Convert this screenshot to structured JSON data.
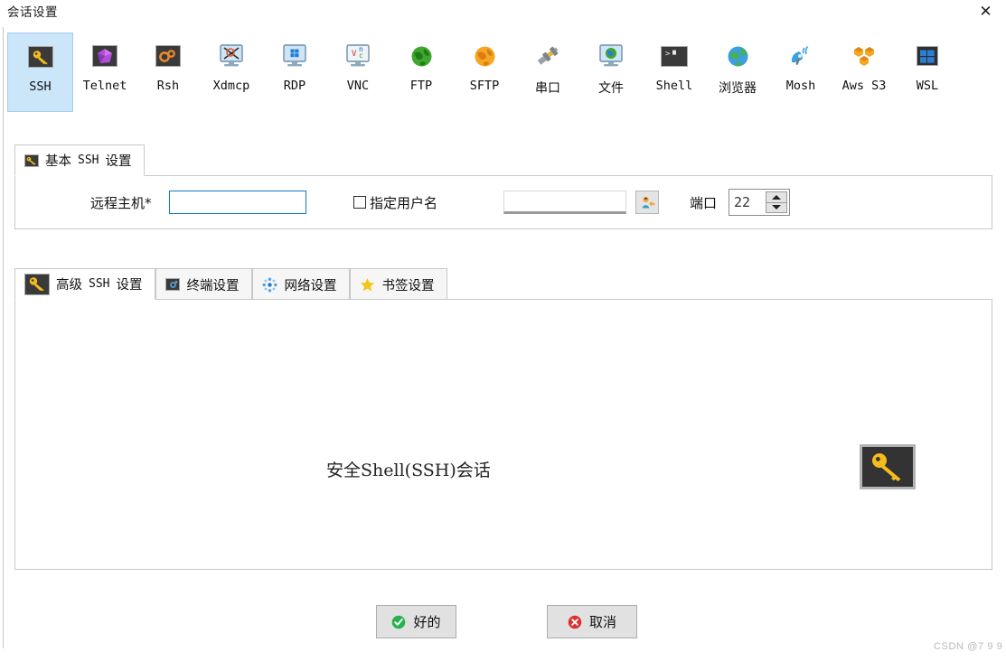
{
  "window": {
    "title": "会话设置",
    "close_label": "✕"
  },
  "protocols": [
    {
      "label": "SSH",
      "icon": "key-icon",
      "selected": true,
      "cjk": false
    },
    {
      "label": "Telnet",
      "icon": "gem-icon",
      "selected": false,
      "cjk": false
    },
    {
      "label": "Rsh",
      "icon": "gears-icon",
      "selected": false,
      "cjk": false
    },
    {
      "label": "Xdmcp",
      "icon": "x-monitor-icon",
      "selected": false,
      "cjk": false
    },
    {
      "label": "RDP",
      "icon": "windows-monitor-icon",
      "selected": false,
      "cjk": false
    },
    {
      "label": "VNC",
      "icon": "vnc-monitor-icon",
      "selected": false,
      "cjk": false
    },
    {
      "label": "FTP",
      "icon": "green-globe-icon",
      "selected": false,
      "cjk": false
    },
    {
      "label": "SFTP",
      "icon": "orange-globe-icon",
      "selected": false,
      "cjk": false
    },
    {
      "label": "串口",
      "icon": "serial-plug-icon",
      "selected": false,
      "cjk": true
    },
    {
      "label": "文件",
      "icon": "file-monitor-icon",
      "selected": false,
      "cjk": true
    },
    {
      "label": "Shell",
      "icon": "terminal-icon",
      "selected": false,
      "cjk": false
    },
    {
      "label": "浏览器",
      "icon": "browser-globe-icon",
      "selected": false,
      "cjk": true
    },
    {
      "label": "Mosh",
      "icon": "satellite-icon",
      "selected": false,
      "cjk": false
    },
    {
      "label": "Aws S3",
      "icon": "aws-cubes-icon",
      "selected": false,
      "cjk": false
    },
    {
      "label": "WSL",
      "icon": "wsl-icon",
      "selected": false,
      "cjk": false
    }
  ],
  "basic_panel": {
    "tab_label_cjk_1": "基本",
    "tab_label_mono": "SSH",
    "tab_label_cjk_2": "设置",
    "tab_icon": "key-icon",
    "host_label": "远程主机*",
    "host_value": "",
    "host_placeholder": "",
    "specify_user_label": "指定用户名",
    "specify_user_checked": false,
    "username_value": "",
    "username_placeholder": "",
    "user_button_icon": "user-key-icon",
    "port_label": "端口",
    "port_value": "22"
  },
  "advanced_panel": {
    "tabs": [
      {
        "icon": "key-icon",
        "cjk1": "高级",
        "mono": "SSH",
        "cjk2": "设置",
        "active": true
      },
      {
        "icon": "terminal-gear-icon",
        "cjk1": "终端设置",
        "mono": "",
        "cjk2": "",
        "active": false
      },
      {
        "icon": "network-dots-icon",
        "cjk1": "网络设置",
        "mono": "",
        "cjk2": "",
        "active": false
      },
      {
        "icon": "star-icon",
        "cjk1": "书签设置",
        "mono": "",
        "cjk2": "",
        "active": false
      }
    ],
    "description": "安全Shell(SSH)会话",
    "big_icon": "key-icon"
  },
  "footer": {
    "ok_label": "好的",
    "ok_icon": "check-circle-icon",
    "cancel_label": "取消",
    "cancel_icon": "x-circle-icon"
  },
  "watermark": "CSDN @7 9 9",
  "colors": {
    "selected_tab_bg": "#cce6f9",
    "focus_border": "#1378c4",
    "ok_green": "#24b24c",
    "cancel_red": "#e03030",
    "key_yellow": "#f5bc1e"
  }
}
